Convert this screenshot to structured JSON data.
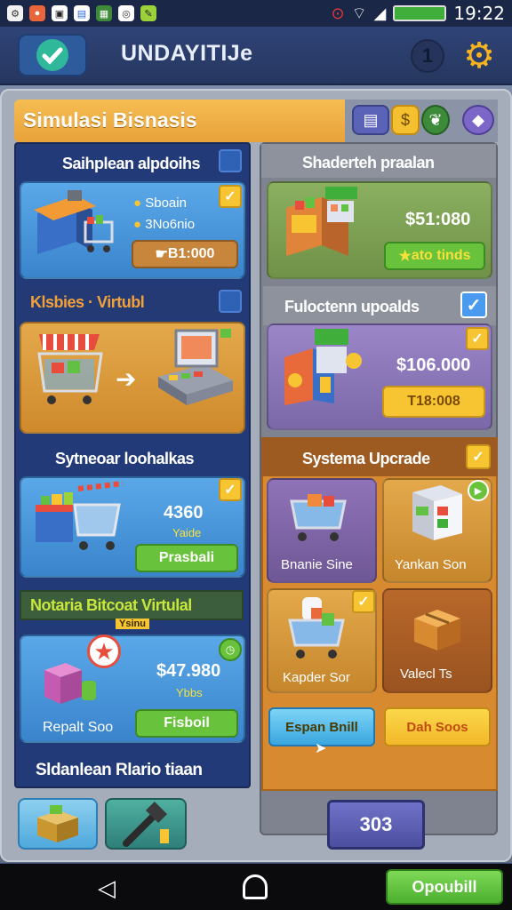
{
  "status": {
    "time": "19:22"
  },
  "app": {
    "title": "UNDAYITIJe",
    "badge": "1"
  },
  "banner": {
    "title": "Simulasi Bisnasis"
  },
  "left": {
    "s1": {
      "head": "Saihplean alpdoihs",
      "line1": "Sboain",
      "line2": "3No6nio",
      "btn": "B1:000"
    },
    "s2": {
      "head": "Klsbies · Virtubl"
    },
    "s3": {
      "head": "Sytneoar loohalkas",
      "value": "4360",
      "sub": "Yaide",
      "btn": "Prasbali"
    },
    "s4": {
      "head": "Notaria Bitcoat Virtulal",
      "tag": "Ysinu",
      "value": "$47.980",
      "sub": "Ybbs",
      "label": "Repalt Soo",
      "btn": "Fisboil"
    },
    "s5": {
      "head": "Sldanlean Rlario tiaan"
    }
  },
  "right": {
    "r1": {
      "head": "Shaderteh praalan",
      "value": "$51:080",
      "btn": "ato tinds"
    },
    "r2": {
      "head": "Fuloctenn upoalds",
      "value": "$106.000",
      "btn": "T18:008"
    },
    "r3": {
      "head": "Systema Upcrade",
      "tiles": [
        "Bnanie Sine",
        "Yankan Son",
        "Kapder Sor",
        "Valecl Ts"
      ],
      "btn_blue": "Espan Bnill",
      "btn_yellow": "Dah Soos"
    },
    "bottom_btn": "303"
  },
  "nav": {
    "action": "Opoubill"
  },
  "colors": {
    "accent_orange": "#e8a23a",
    "green": "#69c23b",
    "yellow": "#f6c531",
    "blue_panel": "#233a78"
  }
}
